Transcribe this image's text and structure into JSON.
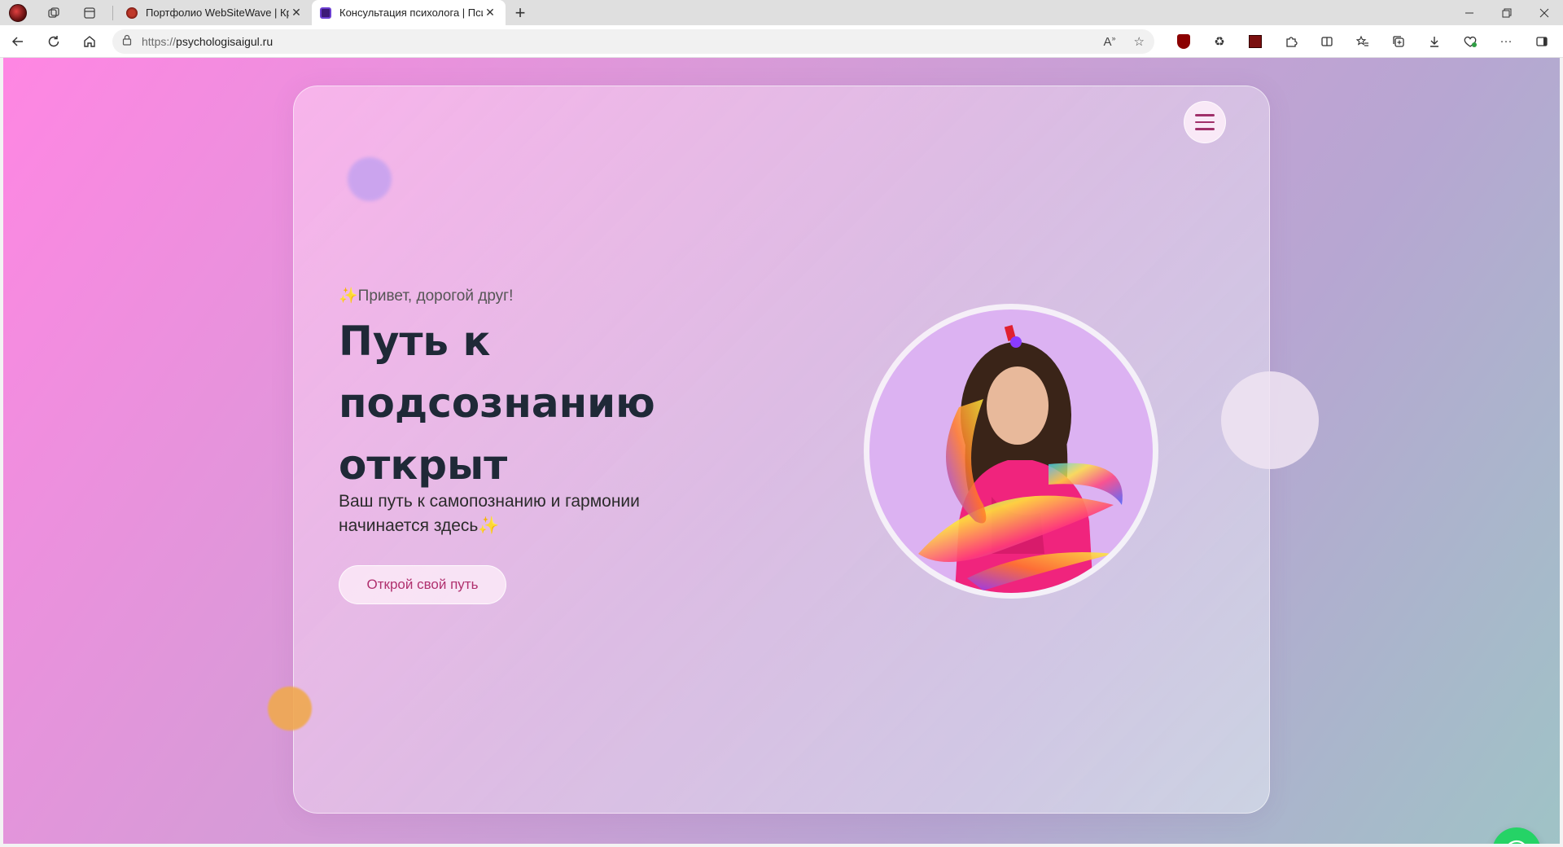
{
  "browser": {
    "tabs": [
      {
        "title": "Портфолио WebSiteWave | Креа",
        "active": false
      },
      {
        "title": "Консультация психолога | Псих",
        "active": true
      }
    ],
    "url_protocol": "https://",
    "url_host": "psychologisaigul.ru"
  },
  "page": {
    "greeting_icon": "✨",
    "greeting": "Привет, дорогой друг!",
    "headline_line1": "Путь к",
    "headline_line2": "подсознанию",
    "headline_line3": "открыт",
    "subtitle_line1": "Ваш путь к самопознанию и гармонии",
    "subtitle_line2": "начинается здесь",
    "subtitle_icon": "✨",
    "cta_label": "Открой свой путь"
  },
  "colors": {
    "accent": "#b0306e",
    "headline": "#1f2937",
    "whatsapp": "#25d366"
  }
}
